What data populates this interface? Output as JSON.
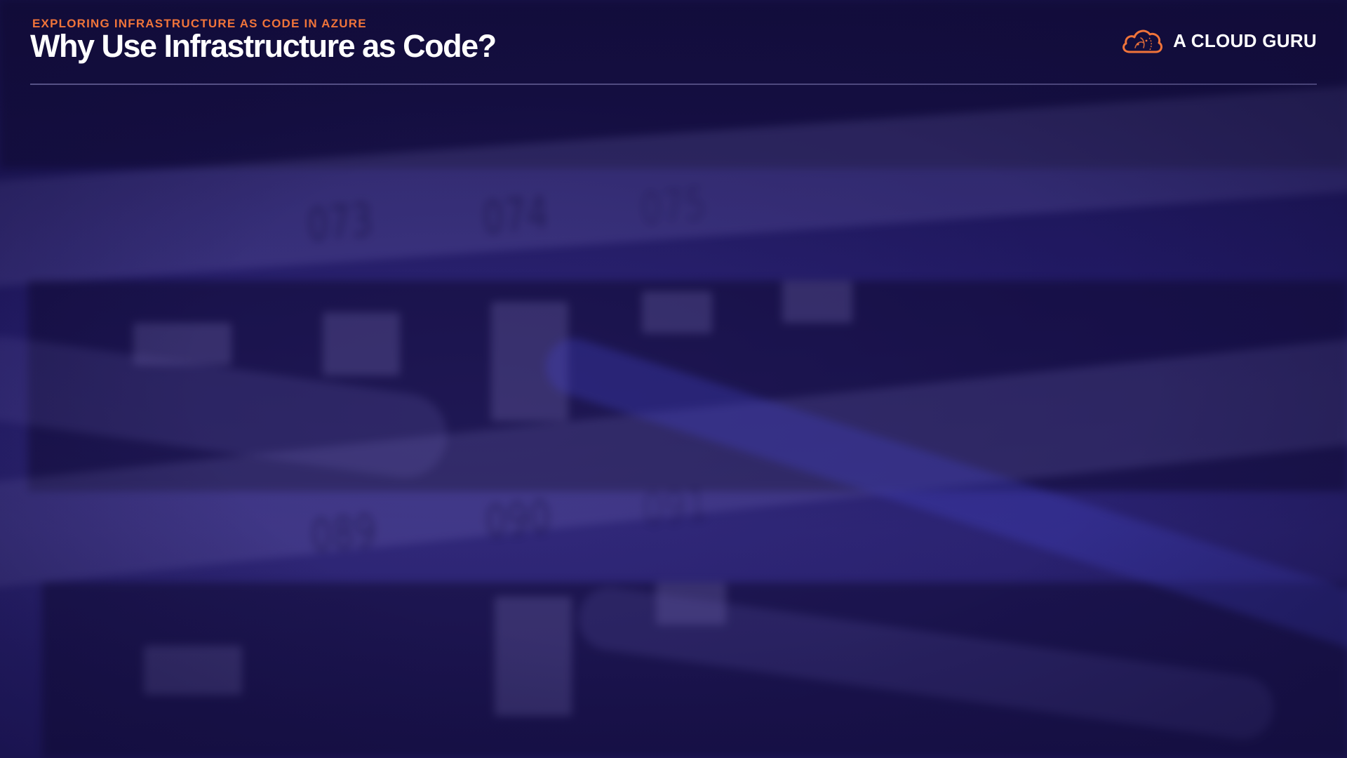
{
  "slide": {
    "eyebrow": "EXPLORING INFRASTRUCTURE AS CODE IN AZURE",
    "title": "Why Use Infrastructure as Code?"
  },
  "brand": {
    "name": "A CLOUD GURU",
    "logo_icon": "cloud-logo-icon",
    "accent_color": "#f0743a"
  },
  "background": {
    "panel_numbers": [
      "073",
      "074",
      "075",
      "089",
      "090",
      "091"
    ],
    "base_color": "#1c1656"
  }
}
